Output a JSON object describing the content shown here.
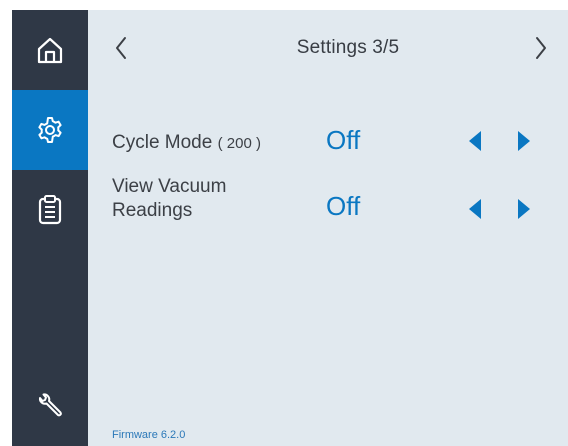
{
  "sidebar": {
    "items": [
      {
        "icon": "home-icon",
        "active": false
      },
      {
        "icon": "gear-icon",
        "active": true
      },
      {
        "icon": "clipboard-icon",
        "active": false
      },
      {
        "icon": "wrench-icon",
        "active": false
      }
    ]
  },
  "header": {
    "title": "Settings",
    "page": "3/5"
  },
  "settings": [
    {
      "label": "Cycle Mode",
      "param": "( 200 )",
      "value": "Off"
    },
    {
      "label_line1": "View Vacuum",
      "label_line2": "Readings",
      "value": "Off"
    }
  ],
  "footer": {
    "firmware": "Firmware 6.2.0"
  },
  "colors": {
    "sidebar": "#2f3846",
    "accent": "#0a77c2",
    "background": "#e1e9ef",
    "text": "#3c4046"
  }
}
